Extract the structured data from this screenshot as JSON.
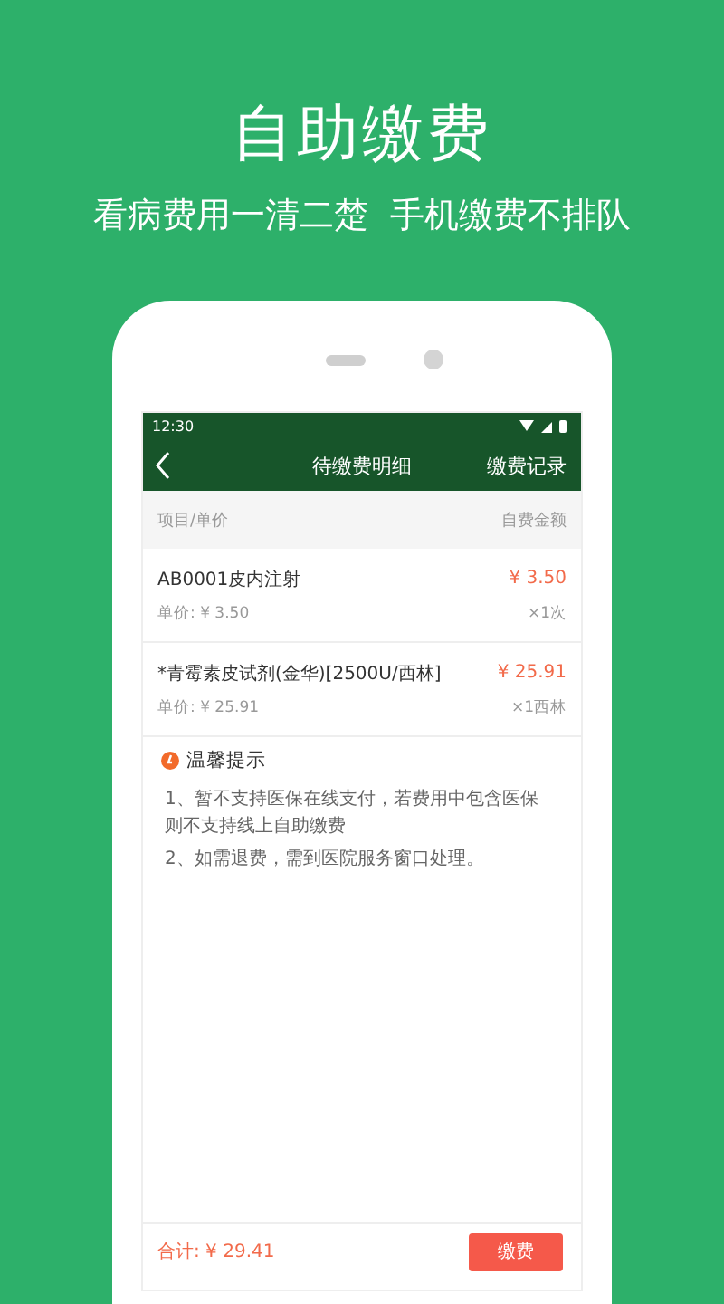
{
  "headline": "自助缴费",
  "subtitle": "看病费用一清二楚  手机缴费不排队",
  "status_bar": {
    "time": "12:30"
  },
  "nav": {
    "title": "待缴费明细",
    "action": "缴费记录"
  },
  "table_header": {
    "column_1": "项目/单价",
    "column_2": "自费金额"
  },
  "items": [
    {
      "name": "AB0001皮内注射",
      "amount": "¥ 3.50",
      "unit_price": "单价: ¥ 3.50",
      "quantity": "×1次"
    },
    {
      "name": "*青霉素皮试剂(金华)[2500U/西林]",
      "amount": "¥ 25.91",
      "unit_price": "单价: ¥ 25.91",
      "quantity": "×1西林"
    }
  ],
  "tips": {
    "title": "温馨提示",
    "lines": [
      "1、暂不支持医保在线支付，若费用中包含医保则不支持线上自助缴费",
      "2、如需退费，需到医院服务窗口处理。"
    ]
  },
  "footer": {
    "total": "合计: ¥ 29.41",
    "pay_button": "缴费"
  }
}
